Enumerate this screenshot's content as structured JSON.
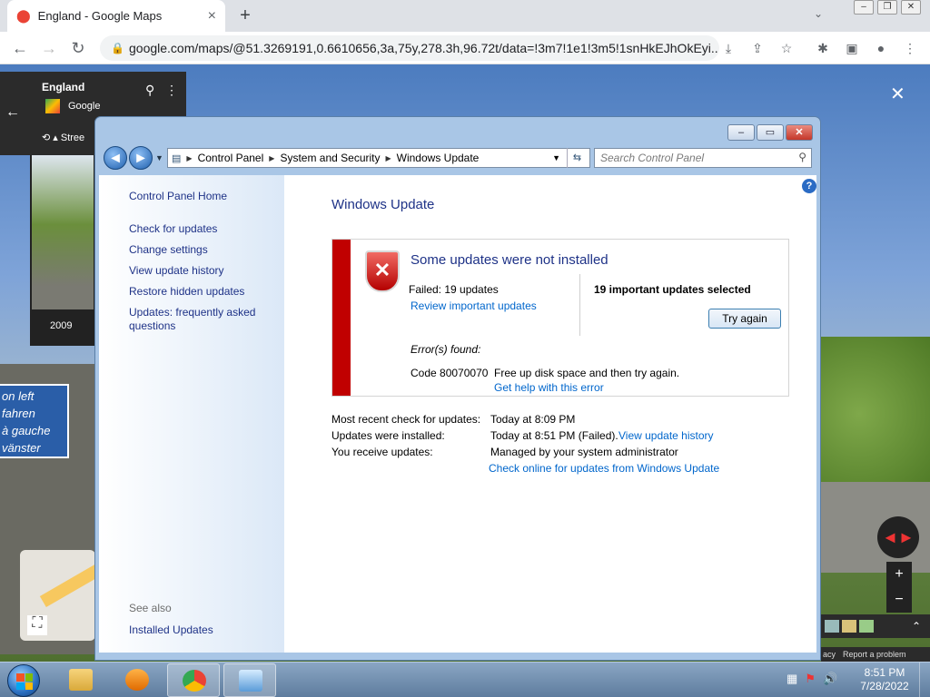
{
  "browser": {
    "tab_title": "England - Google Maps",
    "tab_close": "×",
    "new_tab": "+",
    "tab_search": "⌄",
    "window_controls": [
      "–",
      "❐",
      "✕"
    ],
    "url": "google.com/maps/@51.3269191,0.6610656,3a,75y,278.3h,96.72t/data=!3m7!1e1!3m5!1snHkEJhOkEyi...",
    "back": "←",
    "forward": "→",
    "reload": "↻",
    "toolbar_icons": [
      "⤓",
      "⇪",
      "☆",
      "✱",
      "▣",
      "●",
      "⋮"
    ]
  },
  "maps": {
    "place": "England",
    "source": "Google",
    "back_icon": "←",
    "history": "⟲ ▴",
    "street_label": "Stree",
    "year": "2009",
    "close_icon": "✕",
    "sign_lines": [
      "on left",
      "fahren",
      "à gauche",
      "vänster"
    ],
    "compass": "◄►",
    "zoom_in": "+",
    "zoom_out": "−",
    "expand": "⌃",
    "fullscreen": "⛶",
    "footer": [
      "acy",
      "Report a problem"
    ]
  },
  "window": {
    "title": "Windows Update",
    "caption_buttons": [
      "–",
      "▭",
      "✕"
    ],
    "breadcrumb": [
      "Control Panel",
      "System and Security",
      "Windows Update"
    ],
    "search_placeholder": "Search Control Panel",
    "help": "?"
  },
  "nav": {
    "home": "Control Panel Home",
    "items": [
      "Check for updates",
      "Change settings",
      "View update history",
      "Restore hidden updates",
      "Updates: frequently asked",
      "questions"
    ],
    "see_also": "See also",
    "installed_updates": "Installed Updates"
  },
  "status": {
    "headline": "Some updates were not installed",
    "failed": "Failed: 19 updates",
    "review_link": "Review important updates",
    "selected": "19 important updates selected",
    "try_again": "Try again",
    "errors_found": "Error(s) found:",
    "error_code": "Code 80070070",
    "error_desc": "Free up disk space and then try again.",
    "help_link": "Get help with this error"
  },
  "info": {
    "recent_check_label": "Most recent check for updates:",
    "recent_check_value": "Today at 8:09 PM",
    "installed_label": "Updates were installed:",
    "installed_value": "Today at 8:51 PM (Failed).",
    "history_link": "View update history",
    "receive_label": "You receive updates:",
    "receive_value": "Managed by your system administrator",
    "online_link": "Check online for updates from Windows Update"
  },
  "taskbar": {
    "time": "8:51 PM",
    "date": "7/28/2022",
    "tray_icons": [
      "▦",
      "⚑",
      "🔊"
    ]
  },
  "colors": {
    "link": "#0066cc",
    "heading": "#1e3287",
    "error_stripe": "#c00000"
  }
}
